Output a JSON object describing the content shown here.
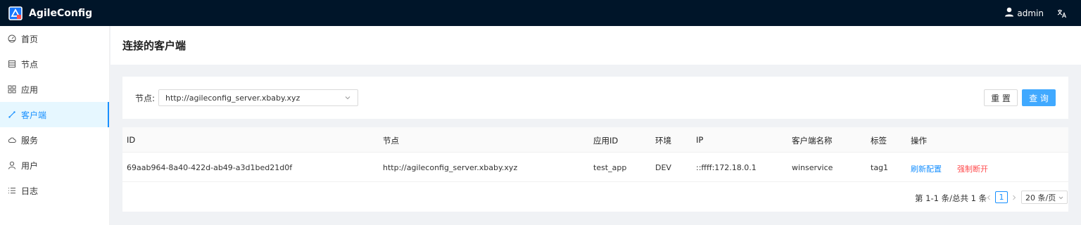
{
  "header": {
    "app_title": "AgileConfig",
    "user_name": "admin",
    "logo_icon": "agileconfig-logo",
    "user_icon": "user-icon",
    "lang_icon": "translate-icon"
  },
  "sidebar": {
    "items": [
      {
        "label": "首页",
        "icon": "dashboard-icon",
        "active": false
      },
      {
        "label": "节点",
        "icon": "node-icon",
        "active": false
      },
      {
        "label": "应用",
        "icon": "appstore-icon",
        "active": false
      },
      {
        "label": "客户端",
        "icon": "client-icon",
        "active": true
      },
      {
        "label": "服务",
        "icon": "cloud-icon",
        "active": false
      },
      {
        "label": "用户",
        "icon": "user-icon",
        "active": false
      },
      {
        "label": "日志",
        "icon": "log-list-icon",
        "active": false
      }
    ]
  },
  "page": {
    "title": "连接的客户端"
  },
  "search": {
    "node_label": "节点:",
    "node_value": "http://agileconfig_server.xbaby.xyz",
    "reset_label": "重 置",
    "query_label": "查 询"
  },
  "table": {
    "columns": [
      "ID",
      "节点",
      "应用ID",
      "环境",
      "IP",
      "客户端名称",
      "标签",
      "操作"
    ],
    "rows": [
      {
        "id": "69aab964-8a40-422d-ab49-a3d1bed21d0f",
        "node": "http://agileconfig_server.xbaby.xyz",
        "app_id": "test_app",
        "env": "DEV",
        "ip": "::ffff:172.18.0.1",
        "client_name": "winservice",
        "tag": "tag1",
        "action_refresh": "刷新配置",
        "action_disconnect": "强制断开"
      }
    ]
  },
  "pagination": {
    "total_text": "第 1-1 条/总共 1 条",
    "current_page": "1",
    "page_size": "20 条/页"
  },
  "colors": {
    "topbar": "#001529",
    "primary": "#1890ff",
    "danger": "#ff4d4f",
    "query_button": "#40a9ff"
  }
}
